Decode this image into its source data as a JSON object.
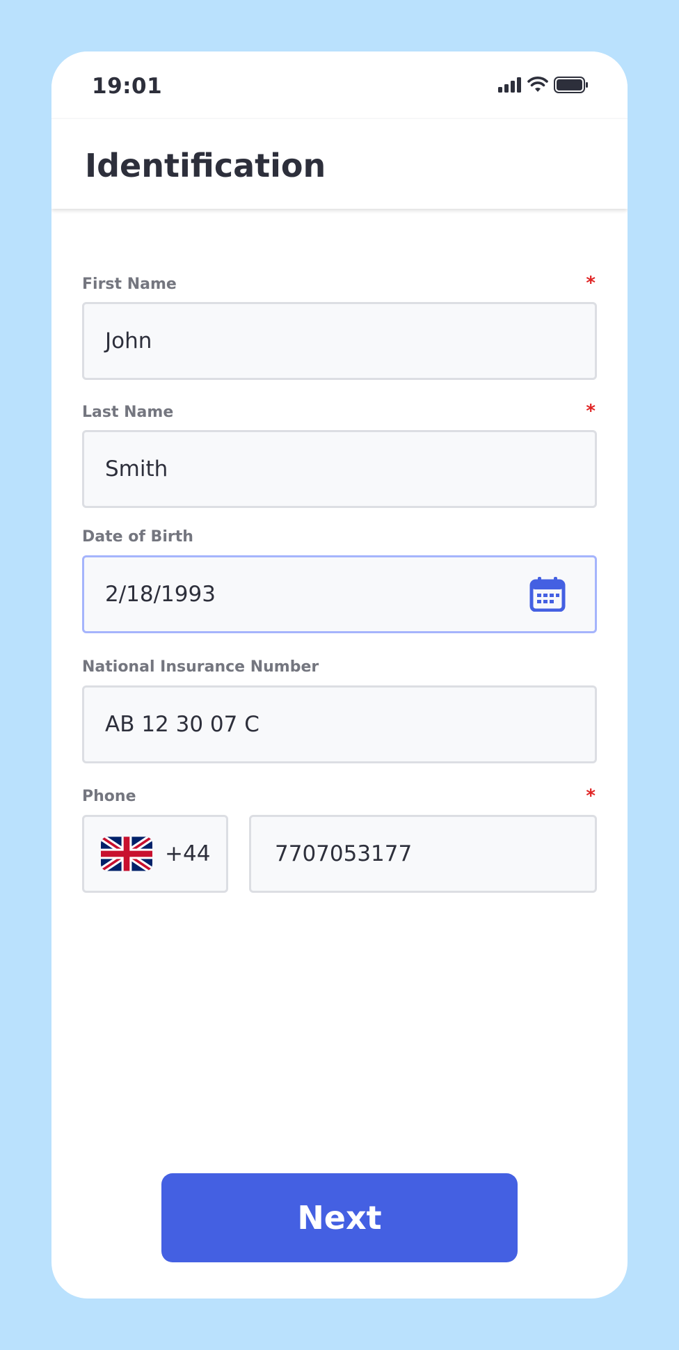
{
  "status_bar": {
    "time": "19:01",
    "icons": [
      "signal-icon",
      "wifi-icon",
      "battery-icon"
    ]
  },
  "header": {
    "title": "Identification"
  },
  "form": {
    "required_mark": "*",
    "first_name": {
      "label": "First Name",
      "value": "John",
      "required": true
    },
    "last_name": {
      "label": "Last Name",
      "value": "Smith",
      "required": true
    },
    "dob": {
      "label": "Date of Birth",
      "value": "2/18/1993",
      "icon": "calendar-icon"
    },
    "nin": {
      "label": "National Insurance Number",
      "value": "AB 12 30 07 C"
    },
    "phone": {
      "label": "Phone",
      "required": true,
      "country_icon": "uk-flag-icon",
      "country_code": "+44",
      "number": "7707053177"
    }
  },
  "actions": {
    "next_label": "Next"
  },
  "colors": {
    "background": "#bae1fd",
    "accent": "#4460e2",
    "required": "#e02424",
    "focus_border": "#a5b4fc"
  }
}
